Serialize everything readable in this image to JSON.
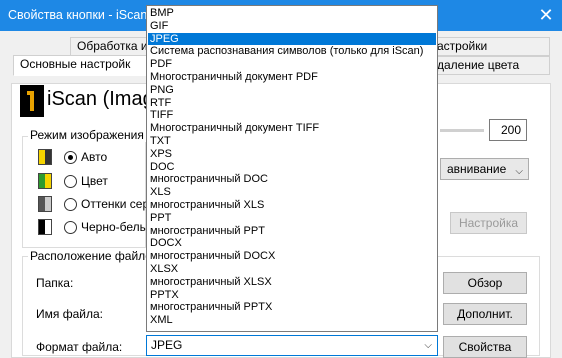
{
  "window": {
    "title": "Свойства кнопки - iScan (I",
    "close_glyph": "✕"
  },
  "tabs_row1": [
    "Обработка из",
    "астройки"
  ],
  "tabs_row2": [
    "Основные настройк",
    "даление цвета"
  ],
  "brand": "iScan (Image",
  "image_mode": {
    "label": "Режим изображения",
    "options": [
      {
        "label": "Авто",
        "checked": true
      },
      {
        "label": "Цвет",
        "checked": false
      },
      {
        "label": "Оттенки сер",
        "checked": false
      },
      {
        "label": "Черно-белый",
        "checked": false
      }
    ]
  },
  "resolution": {
    "value": "200"
  },
  "quality_combo": {
    "value": "авнивание",
    "chevron": "⌵"
  },
  "settings_button": "Настройка",
  "file_location": {
    "label": "Расположение файлов",
    "folder_label": "Папка:",
    "filename_label": "Имя файла:",
    "format_label": "Формат файла:",
    "browse_button": "Обзор",
    "extra_button": "Дополнит.",
    "properties_button": "Свойства"
  },
  "format_dropdown": {
    "selected": "JPEG",
    "chevron": "⌵",
    "options": [
      "BMP",
      "GIF",
      "JPEG",
      "Система распознавания символов (только для iScan)",
      "PDF",
      "Многостраничный документ PDF",
      "PNG",
      "RTF",
      "TIFF",
      "Многостраничный документ TIFF",
      "TXT",
      "XPS",
      "DOC",
      "многостраничный DOC",
      "XLS",
      "многостраничный XLS",
      "PPT",
      "многостраничный PPT",
      "DOCX",
      "многостраничный DOCX",
      "XLSX",
      "многостраничный XLSX",
      "PPTX",
      "многостраничный PPTX",
      "XML"
    ]
  },
  "colors": {
    "titlebar": "#1e88e5",
    "selection": "#0078d7"
  }
}
